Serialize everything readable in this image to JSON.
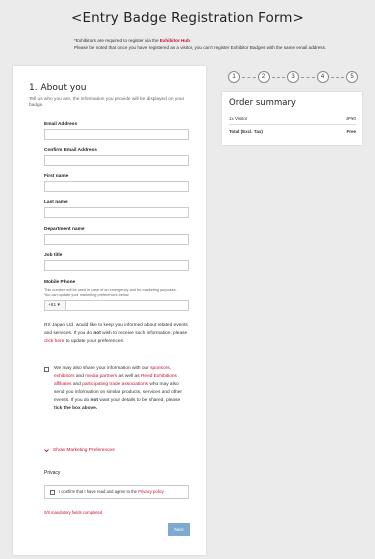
{
  "page": {
    "title": "<Entry Badge Registration Form>"
  },
  "notice": {
    "line1_prefix": "*Exhibitors are required to register via the ",
    "line1_link": "Exhibitor Hub",
    "line2": "Please be noted that once you have registered as a visitor, you can't register Exhibitor Badges with the same email address."
  },
  "steps": [
    "1",
    "2",
    "3",
    "4",
    "5"
  ],
  "form": {
    "title": "1. About you",
    "subtitle": "Tell us who you are, the information you provide will be displayed on your badge.",
    "fields": {
      "email": "Email Address",
      "confirm_email": "Confirm Email Address",
      "first_name": "First name",
      "last_name": "Last name",
      "department": "Department name",
      "job_title": "Job title",
      "mobile": "Mobile Phone"
    },
    "mobile_help": "This number will be used in case of an emergency and for marketing purposes. You can update your marketing preferences below.",
    "phone_prefix": "+81",
    "consent": {
      "part1": "RX Japan Ltd. would like to keep you informed about related events and services. If you do ",
      "not": "not",
      "part2": " wish to receive such information, please ",
      "click_here": "click here",
      "part3": " to update your preferences."
    },
    "share": {
      "p1": "We may also share your information with our ",
      "sponsors": "sponsors",
      "p2": ", ",
      "exhibitors": "exhibitors",
      "p3": " and ",
      "media": "media partners",
      "p4": " as well as ",
      "reed": "Reed Exhibitions affiliates",
      "p5": " and ",
      "trade": "participating trade associations",
      "p6": " who may also send you information on similar products, services and other events. If you do ",
      "not": "not",
      "p7": " want your details to be shared, please ",
      "tick": "tick the box above."
    },
    "show_marketing": "Show Marketing Preferences",
    "privacy_label": "Privacy",
    "privacy_text": "I confirm that I have read and agree to the ",
    "privacy_link": "Privacy policy",
    "mandatory": "0/8 mandatory fields completed",
    "next": "Next"
  },
  "order": {
    "title": "Order summary",
    "item": "1x Visitor",
    "item_price": "JP¥0",
    "total_label": "Total (Excl. Tax)",
    "total_value": "Free"
  },
  "colors": {
    "accent": "#c8102e",
    "button": "#7fa9cf",
    "background": "#ebebeb"
  }
}
